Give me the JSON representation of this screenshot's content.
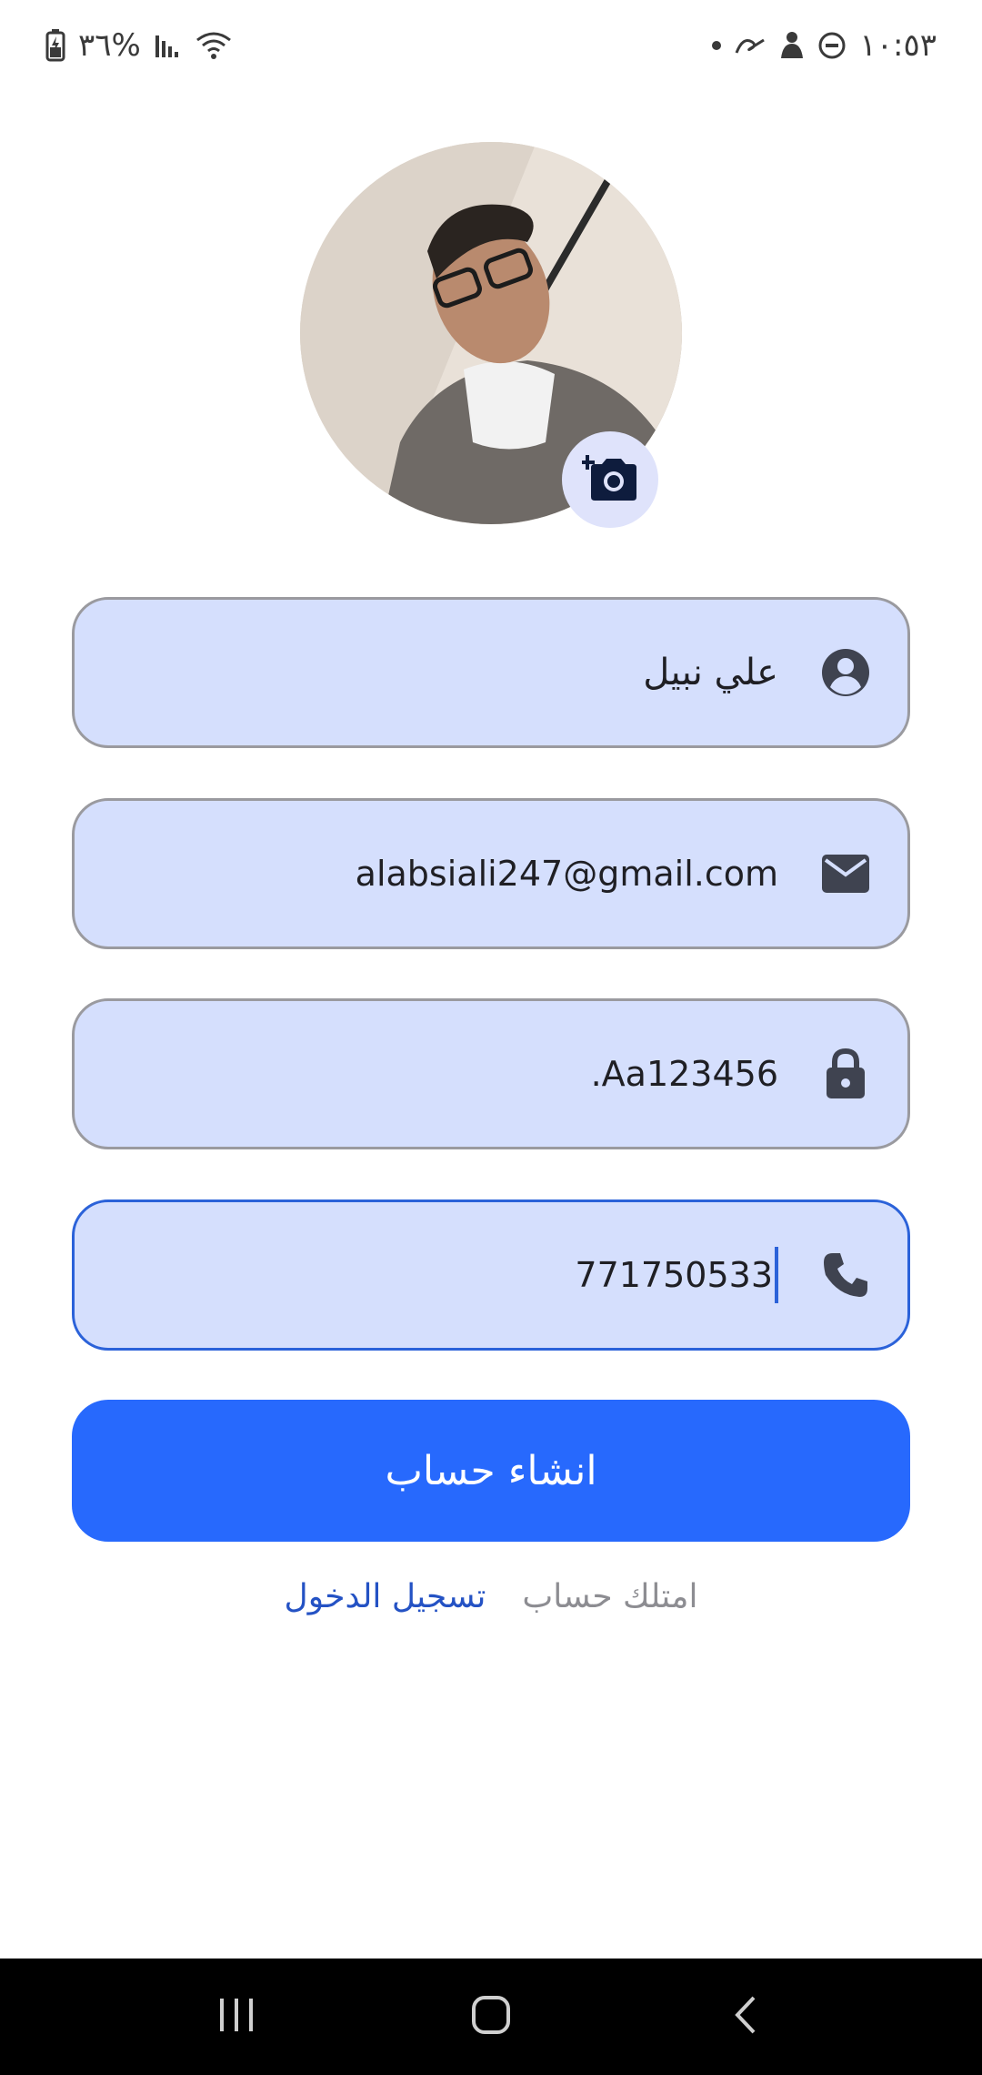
{
  "status_bar": {
    "battery_percent": "٣٦%",
    "time": "١٠:٥٣"
  },
  "profile": {
    "avatar_alt": "",
    "camera_icon": "add-photo-icon"
  },
  "form": {
    "name_value": "علي نبيل",
    "email_value": "alabsiali247@gmail.com",
    "password_value": ".Aa123456",
    "phone_value": "771750533",
    "icons": {
      "name": "person-circle-icon",
      "email": "mail-icon",
      "password": "lock-icon",
      "phone": "phone-icon"
    }
  },
  "actions": {
    "create_account_label": "انشاء حساب",
    "have_account_text": "امتلك حساب",
    "login_link_label": "تسجيل الدخول"
  },
  "colors": {
    "field_bg": "#d5dffd",
    "primary": "#2769fd",
    "focus_border": "#2b62d9",
    "link": "#2452c4",
    "icon_dark": "#3f4350"
  },
  "nav": {
    "recents_icon": "recents-icon",
    "home_icon": "home-icon",
    "back_icon": "back-icon"
  }
}
